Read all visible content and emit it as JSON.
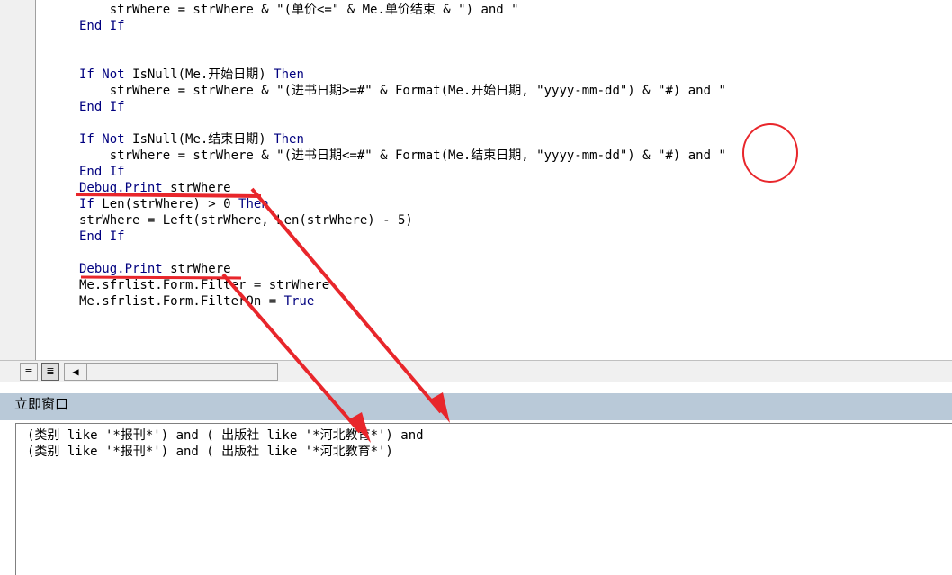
{
  "code": {
    "lines": [
      {
        "indent": "    ",
        "parts": [
          {
            "t": "strWhere = strWhere & \"(单价<=\" & Me.单价结束 & \") and \"",
            "k": false
          }
        ]
      },
      {
        "indent": "",
        "parts": [
          {
            "t": "End If",
            "k": true
          }
        ]
      },
      {
        "indent": "",
        "parts": []
      },
      {
        "indent": "",
        "parts": []
      },
      {
        "indent": "",
        "parts": [
          {
            "t": "If Not ",
            "k": true
          },
          {
            "t": "IsNull(Me.开始日期) ",
            "k": false
          },
          {
            "t": "Then",
            "k": true
          }
        ]
      },
      {
        "indent": "    ",
        "parts": [
          {
            "t": "strWhere = strWhere & \"(进书日期>=#\" & Format(Me.开始日期, \"yyyy-mm-dd\") & \"#) and \"",
            "k": false
          }
        ]
      },
      {
        "indent": "",
        "parts": [
          {
            "t": "End If",
            "k": true
          }
        ]
      },
      {
        "indent": "",
        "parts": []
      },
      {
        "indent": "",
        "parts": [
          {
            "t": "If Not ",
            "k": true
          },
          {
            "t": "IsNull(Me.结束日期) ",
            "k": false
          },
          {
            "t": "Then",
            "k": true
          }
        ]
      },
      {
        "indent": "    ",
        "parts": [
          {
            "t": "strWhere = strWhere & \"(进书日期<=#\" & Format(Me.结束日期, \"yyyy-mm-dd\") & \"#) and \"",
            "k": false
          }
        ]
      },
      {
        "indent": "",
        "parts": [
          {
            "t": "End If",
            "k": true
          }
        ]
      },
      {
        "indent": "",
        "parts": [
          {
            "t": "Debug.Print ",
            "k": true
          },
          {
            "t": "strWhere",
            "k": false
          }
        ]
      },
      {
        "indent": "",
        "parts": [
          {
            "t": "If ",
            "k": true
          },
          {
            "t": "Len(strWhere) > 0 ",
            "k": false
          },
          {
            "t": "Then",
            "k": true
          }
        ]
      },
      {
        "indent": "",
        "parts": [
          {
            "t": "strWhere = Left(strWhere, Len(strWhere) - 5)",
            "k": false
          }
        ]
      },
      {
        "indent": "",
        "parts": [
          {
            "t": "End If",
            "k": true
          }
        ]
      },
      {
        "indent": "",
        "parts": []
      },
      {
        "indent": "",
        "parts": [
          {
            "t": "Debug.Print ",
            "k": true
          },
          {
            "t": "strWhere",
            "k": false
          }
        ]
      },
      {
        "indent": "",
        "parts": [
          {
            "t": "Me.sfrlist.Form.Filter = strWhere",
            "k": false
          }
        ]
      },
      {
        "indent": "",
        "parts": [
          {
            "t": "Me.sfrlist.Form.FilterOn = ",
            "k": false
          },
          {
            "t": "True",
            "k": true
          }
        ]
      }
    ]
  },
  "toolbar": {
    "procedure_view_icon": "≡",
    "module_view_icon": "≣",
    "scroll_left_icon": "◀"
  },
  "immediate": {
    "title": "立即窗口",
    "lines": [
      "(类别 like '*报刊*') and ( 出版社 like '*河北教育*') and",
      "(类别 like '*报刊*') and ( 出版社 like '*河北教育*')"
    ]
  },
  "colors": {
    "keyword": "#00007f",
    "annotation": "#e8262b",
    "title_bar": "#b9c9d8"
  }
}
